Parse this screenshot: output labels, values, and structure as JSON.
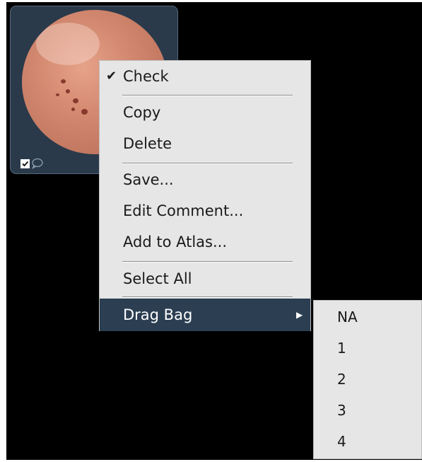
{
  "thumbnail": {
    "checked": true,
    "icons": [
      "checkbox-icon",
      "comment-bubble-icon"
    ]
  },
  "menu": {
    "items": [
      {
        "label": "Check",
        "checked": true
      },
      {
        "label": "Copy"
      },
      {
        "label": "Delete"
      },
      {
        "label": "Save..."
      },
      {
        "label": "Edit Comment..."
      },
      {
        "label": "Add to Atlas..."
      },
      {
        "label": "Select All"
      },
      {
        "label": "Drag Bag",
        "has_submenu": true,
        "highlighted": true
      }
    ],
    "check_mark": "✔",
    "submenu_arrow": "▶"
  },
  "submenu": {
    "items": [
      "NA",
      "1",
      "2",
      "3",
      "4"
    ]
  },
  "colors": {
    "background": "#000000",
    "menu_bg": "#e6e6e6",
    "highlight": "#2b3e52",
    "thumb_frame": "#2a3a4b"
  }
}
